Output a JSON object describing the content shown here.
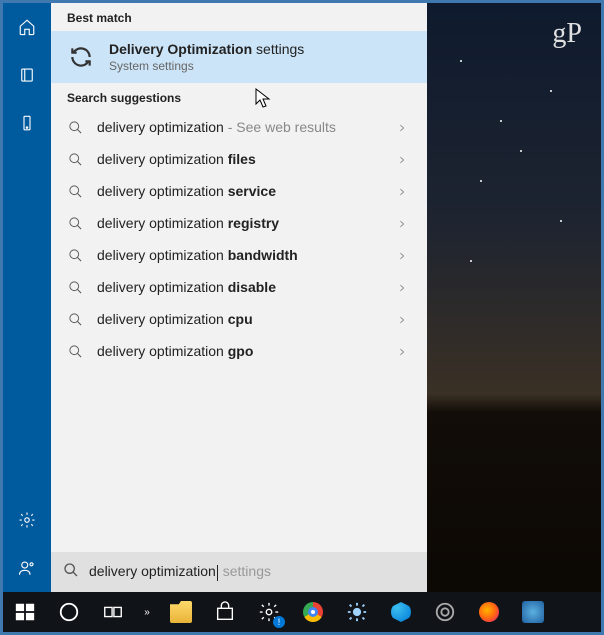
{
  "watermark": "gP",
  "sidebar": {
    "items": [
      {
        "name": "home-icon"
      },
      {
        "name": "notebook-icon"
      },
      {
        "name": "device-icon"
      }
    ],
    "bottom_items": [
      {
        "name": "gear-icon"
      },
      {
        "name": "feedback-icon"
      }
    ]
  },
  "section_headers": {
    "best_match": "Best match",
    "suggestions": "Search suggestions"
  },
  "best_match": {
    "title_bold": "Delivery Optimization",
    "title_rest": " settings",
    "subtitle": "System settings"
  },
  "suggestions": [
    {
      "prefix": "delivery optimization",
      "bold": "",
      "suffix_gray": " - See web results"
    },
    {
      "prefix": "delivery optimization ",
      "bold": "files",
      "suffix_gray": ""
    },
    {
      "prefix": "delivery optimization ",
      "bold": "service",
      "suffix_gray": ""
    },
    {
      "prefix": "delivery optimization ",
      "bold": "registry",
      "suffix_gray": ""
    },
    {
      "prefix": "delivery optimization ",
      "bold": "bandwidth",
      "suffix_gray": ""
    },
    {
      "prefix": "delivery optimization ",
      "bold": "disable",
      "suffix_gray": ""
    },
    {
      "prefix": "delivery optimization ",
      "bold": "cpu",
      "suffix_gray": ""
    },
    {
      "prefix": "delivery optimization ",
      "bold": "gpo",
      "suffix_gray": ""
    }
  ],
  "search": {
    "typed": "delivery optimization",
    "hint": " settings"
  },
  "taskbar": [
    {
      "name": "start-button"
    },
    {
      "name": "cortana-button"
    },
    {
      "name": "task-view-button"
    },
    {
      "name": "overflow-button"
    },
    {
      "name": "file-explorer-button"
    },
    {
      "name": "store-button"
    },
    {
      "name": "settings-button"
    },
    {
      "name": "chrome-button"
    },
    {
      "name": "brightness-button"
    },
    {
      "name": "edge-button"
    },
    {
      "name": "camera-button"
    },
    {
      "name": "firefox-button"
    },
    {
      "name": "app-button"
    }
  ]
}
